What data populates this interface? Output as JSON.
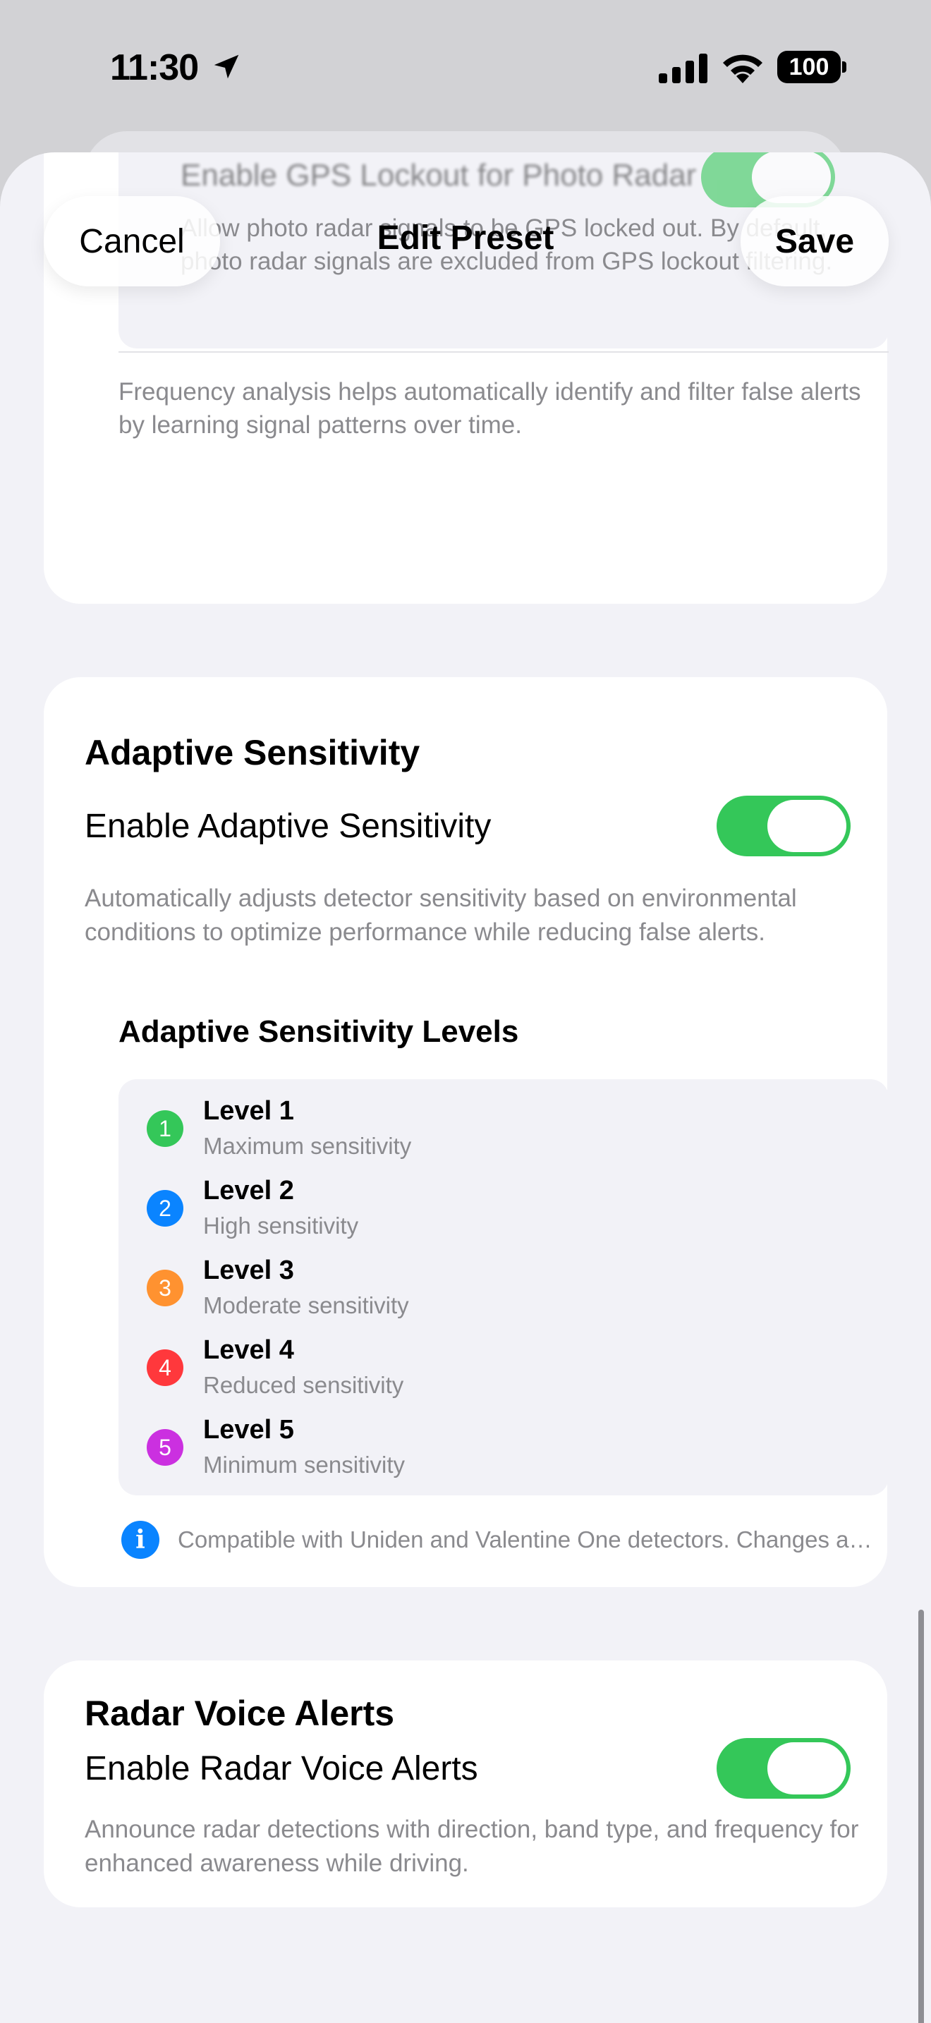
{
  "status_bar": {
    "time": "11:30",
    "battery": "100"
  },
  "header": {
    "cancel": "Cancel",
    "title": "Edit Preset",
    "save": "Save"
  },
  "frequency_section": {
    "gps_title": "Enable GPS Lockout for Photo Radar",
    "gps_desc": "Allow photo radar signals to be GPS locked out. By default, photo radar signals are excluded from GPS lockout filtering.",
    "footer": "Frequency analysis helps automatically identify and filter false alerts by learning signal patterns over time."
  },
  "adaptive": {
    "title": "Adaptive Sensitivity",
    "toggle_label": "Enable Adaptive Sensitivity",
    "toggle_on": true,
    "desc": "Automatically adjusts detector sensitivity based on environmental conditions to optimize performance while reducing false alerts.",
    "levels_title": "Adaptive Sensitivity Levels",
    "levels": [
      {
        "num": "1",
        "name": "Level 1",
        "sub": "Maximum sensitivity",
        "color": "#34c759"
      },
      {
        "num": "2",
        "name": "Level 2",
        "sub": "High sensitivity",
        "color": "#0a84ff"
      },
      {
        "num": "3",
        "name": "Level 3",
        "sub": "Moderate sensitivity",
        "color": "#ff9230"
      },
      {
        "num": "4",
        "name": "Level 4",
        "sub": "Reduced sensitivity",
        "color": "#ff383c"
      },
      {
        "num": "5",
        "name": "Level 5",
        "sub": "Minimum sensitivity",
        "color": "#cb30e0"
      }
    ],
    "info": "Compatible with Uniden and Valentine One detectors. Changes apply when connected."
  },
  "voice": {
    "title": "Radar Voice Alerts",
    "toggle_label": "Enable Radar Voice Alerts",
    "toggle_on": true,
    "desc": "Announce radar detections with direction, band type, and frequency for enhanced awareness while driving."
  }
}
